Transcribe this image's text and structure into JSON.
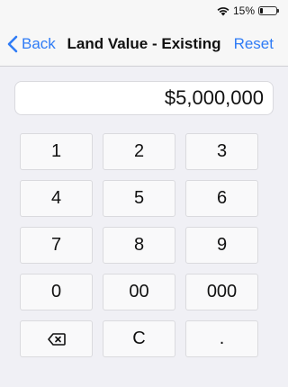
{
  "status_bar": {
    "battery_percent": "15%",
    "battery_level": 0.15,
    "icons": [
      "wifi-icon",
      "battery-icon"
    ]
  },
  "nav": {
    "back_label": "Back",
    "title": "Land Value - Existing",
    "reset_label": "Reset",
    "accent_color": "#2f7cf6"
  },
  "display": {
    "value": "$5,000,000"
  },
  "keypad": {
    "keys": [
      "1",
      "2",
      "3",
      "4",
      "5",
      "6",
      "7",
      "8",
      "9",
      "0",
      "00",
      "000",
      "",
      "C",
      "."
    ],
    "backspace_icon": "backspace-icon"
  }
}
